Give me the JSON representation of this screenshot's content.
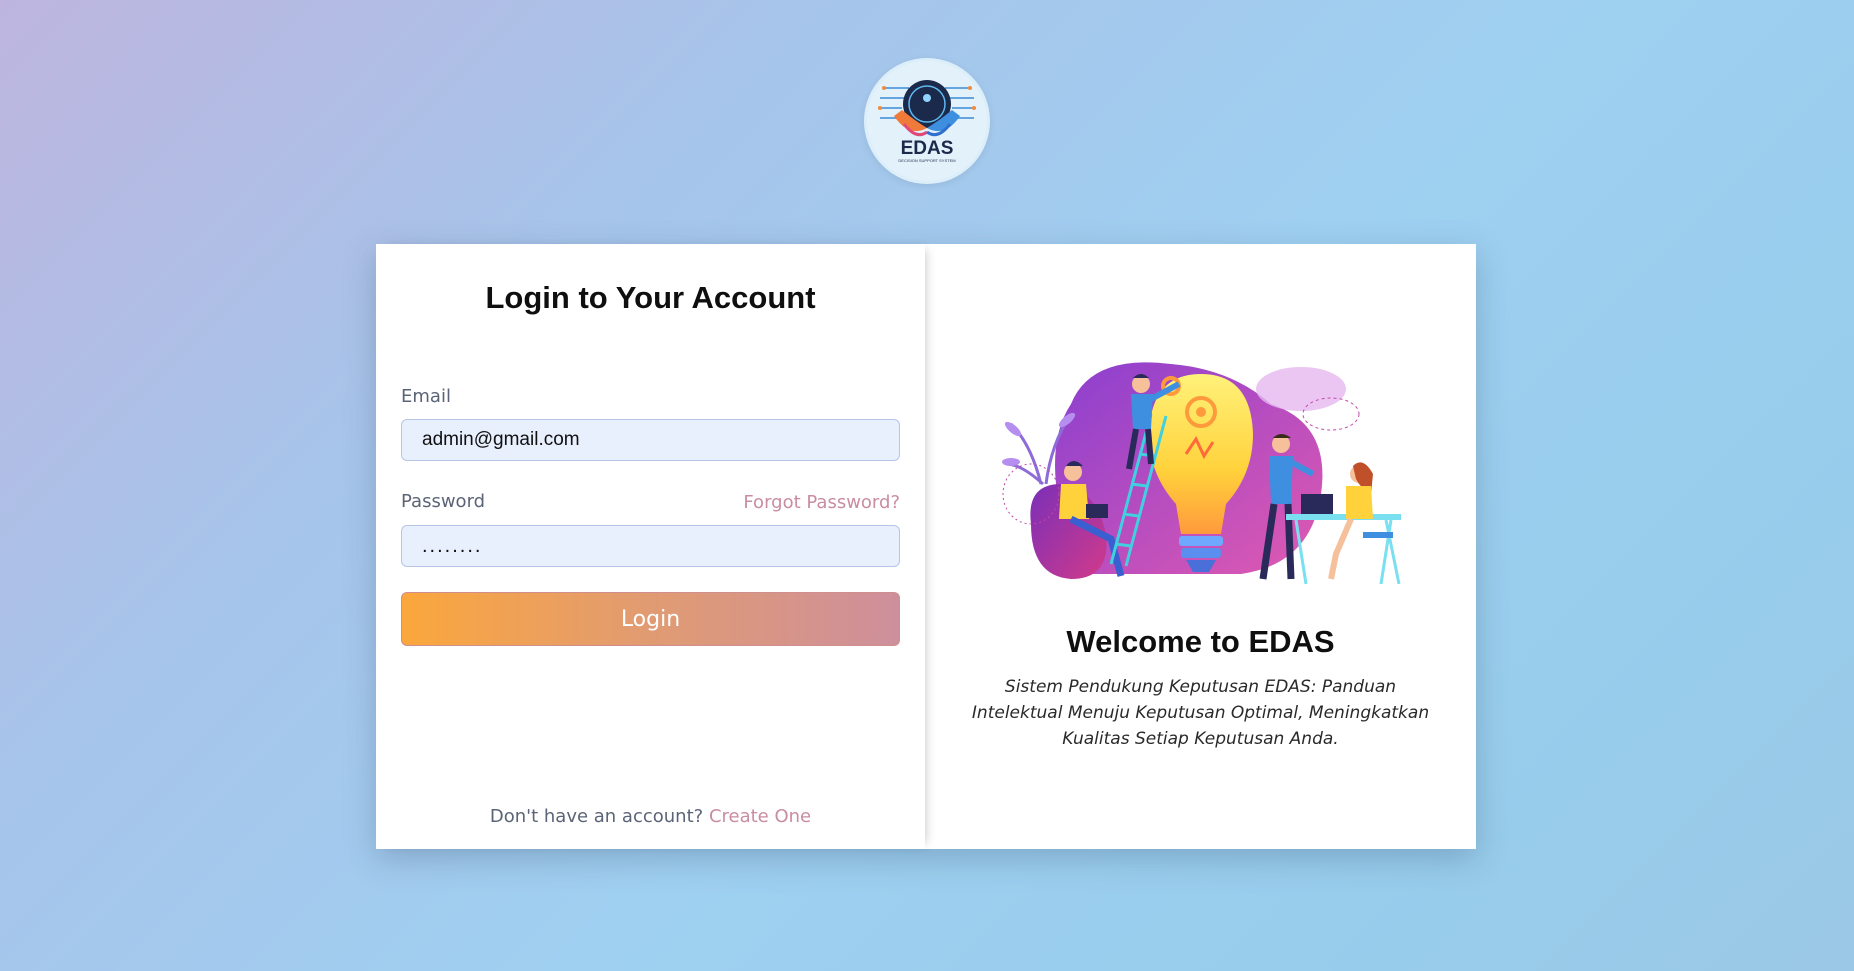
{
  "logo": {
    "text": "EDAS",
    "subtext": "DECISION SUPPORT SYSTEM"
  },
  "login": {
    "title": "Login to Your Account",
    "email_label": "Email",
    "email_value": "admin@gmail.com",
    "password_label": "Password",
    "password_value": "........",
    "forgot_label": "Forgot Password?",
    "button_label": "Login",
    "signup_prompt": "Don't have an account?",
    "signup_link": "Create One"
  },
  "welcome": {
    "title": "Welcome to EDAS",
    "description": "Sistem Pendukung Keputusan EDAS: Panduan Intelektual Menuju Keputusan Optimal, Meningkatkan Kualitas Setiap Keputusan Anda."
  },
  "colors": {
    "accent_pink": "#c98da0",
    "button_start": "#fba73c",
    "button_end": "#cd8f9c",
    "input_bg": "#e8effd"
  }
}
